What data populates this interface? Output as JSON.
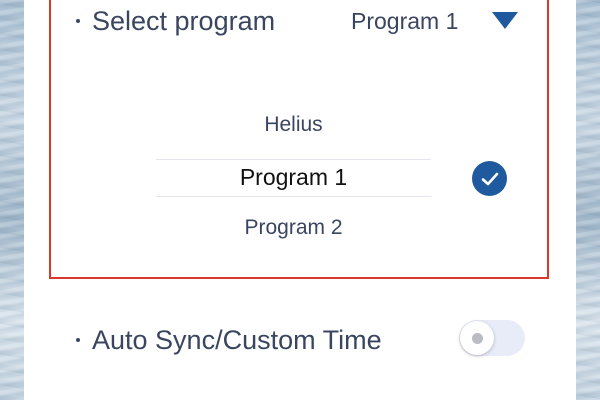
{
  "settings": {
    "select_program": {
      "label": "Select program",
      "selected_value": "Program 1",
      "options": [
        {
          "label": "Helius",
          "selected": false
        },
        {
          "label": "Program 1",
          "selected": true
        },
        {
          "label": "Program 2",
          "selected": false
        }
      ]
    },
    "auto_sync": {
      "label": "Auto Sync/Custom Time",
      "enabled": false
    }
  },
  "colors": {
    "accent": "#1f5a9e",
    "highlight_border": "#d9392b",
    "text": "#3a4560",
    "toggle_track": "#e8ebf8"
  },
  "icons": {
    "dropdown": "caret-down-icon",
    "selected": "check-circle-icon",
    "bullet": "bullet-dot-icon"
  }
}
